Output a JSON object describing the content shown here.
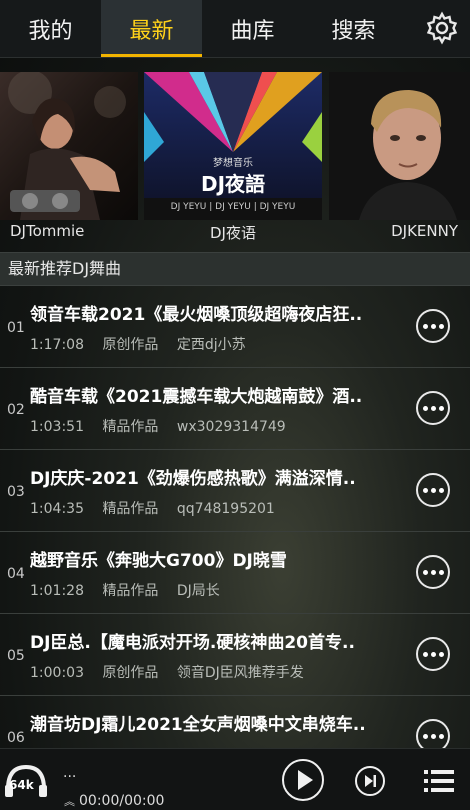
{
  "tabs": [
    {
      "label": "我的",
      "active": false
    },
    {
      "label": "最新",
      "active": true
    },
    {
      "label": "曲库",
      "active": false
    },
    {
      "label": "搜索",
      "active": false
    }
  ],
  "banner": {
    "djs": [
      {
        "name": "DJTommie"
      },
      {
        "name": "DJ夜语",
        "art_title": "DJ夜語",
        "art_subtitle": "梦想音乐",
        "art_strip": "DJ YEYU | DJ YEYU | DJ YEYU"
      },
      {
        "name": "DJKENNY"
      }
    ]
  },
  "section": {
    "title": "最新推荐DJ舞曲"
  },
  "songs": [
    {
      "num": "01",
      "title": "领音车载2021《最火烟嗓顶级超嗨夜店狂..",
      "duration": "1:17:08",
      "category": "原创作品",
      "author": "定西dj小苏"
    },
    {
      "num": "02",
      "title": "酷音车载《2021震撼车载大炮越南鼓》酒..",
      "duration": "1:03:51",
      "category": "精品作品",
      "author": "wx3029314749"
    },
    {
      "num": "03",
      "title": "DJ庆庆-2021《劲爆伤感热歌》满溢深情..",
      "duration": "1:04:35",
      "category": "精品作品",
      "author": "qq748195201"
    },
    {
      "num": "04",
      "title": "越野音乐《奔驰大G700》DJ晓雪",
      "duration": "1:01:28",
      "category": "精品作品",
      "author": "DJ局长"
    },
    {
      "num": "05",
      "title": "DJ臣总.【魔电派对开场.硬核神曲20首专..",
      "duration": "1:00:03",
      "category": "原创作品",
      "author": "领音DJ臣风推荐手发"
    },
    {
      "num": "06",
      "title": "潮音坊DJ霜儿2021全女声烟嗓中文串烧车..",
      "duration": "",
      "category": "",
      "author": ""
    }
  ],
  "player": {
    "bitrate": "64k",
    "now_playing": "...",
    "time": "00:00/00:00"
  },
  "colors": {
    "active_tab_text": "#ffd21a",
    "active_tab_underline": "#f2b400"
  },
  "icons": [
    "gear-icon",
    "more-icon",
    "headphones-icon",
    "play-icon",
    "next-icon",
    "playlist-icon",
    "chevron-up-icon"
  ]
}
